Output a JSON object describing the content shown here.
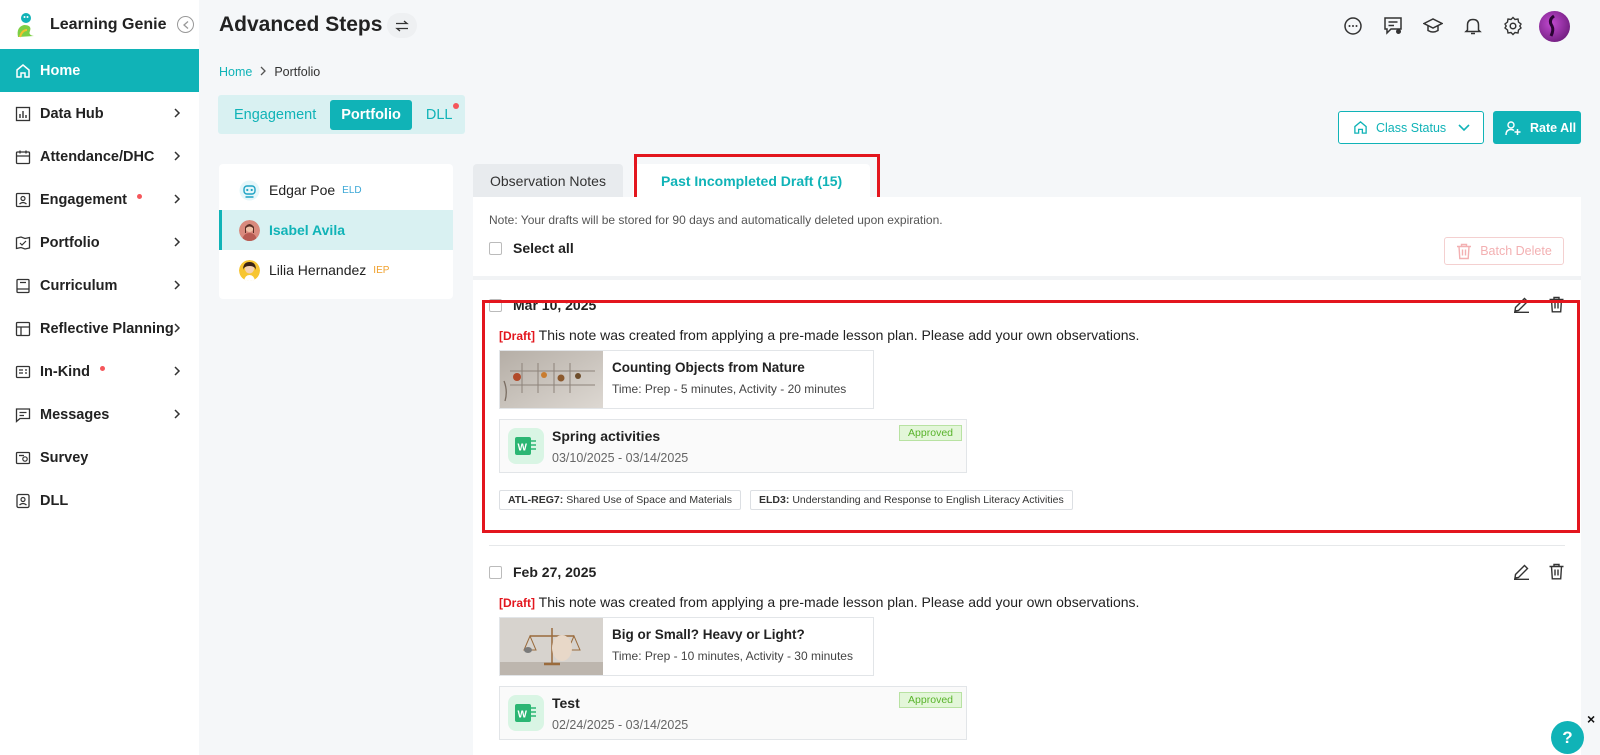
{
  "app": {
    "name": "Learning Genie",
    "logo_icon": "genie-logo-icon"
  },
  "sidebar": {
    "items": [
      {
        "label": "Home",
        "icon": "home-icon",
        "active": true,
        "dot": false,
        "chevron": false
      },
      {
        "label": "Data Hub",
        "icon": "bar-chart-icon",
        "dot": false,
        "chevron": true
      },
      {
        "label": "Attendance/DHC",
        "icon": "calendar-icon",
        "dot": false,
        "chevron": true
      },
      {
        "label": "Engagement",
        "icon": "engagement-icon",
        "dot": true,
        "chevron": true
      },
      {
        "label": "Portfolio",
        "icon": "portfolio-icon",
        "dot": false,
        "chevron": true
      },
      {
        "label": "Curriculum",
        "icon": "book-icon",
        "dot": false,
        "chevron": true
      },
      {
        "label": "Reflective Planning",
        "icon": "planning-icon",
        "dot": false,
        "chevron": true
      },
      {
        "label": "In-Kind",
        "icon": "inkind-icon",
        "dot": true,
        "chevron": true
      },
      {
        "label": "Messages",
        "icon": "message-icon",
        "dot": false,
        "chevron": true
      },
      {
        "label": "Survey",
        "icon": "survey-icon",
        "dot": false,
        "chevron": false
      },
      {
        "label": "DLL",
        "icon": "dll-icon",
        "dot": false,
        "chevron": false
      }
    ]
  },
  "header": {
    "title": "Advanced Steps",
    "icons": [
      "chat-icon",
      "notes-icon",
      "graduation-cap-icon",
      "bell-icon",
      "gear-icon",
      "avatar"
    ]
  },
  "breadcrumb": {
    "home": "Home",
    "current": "Portfolio"
  },
  "subtabs": [
    {
      "label": "Engagement",
      "active": false
    },
    {
      "label": "Portfolio",
      "active": true
    },
    {
      "label": "DLL",
      "active": false,
      "dot": true
    }
  ],
  "actions": {
    "class_status": "Class Status",
    "rate_all": "Rate All"
  },
  "children": [
    {
      "name": "Edgar Poe",
      "tag": "ELD",
      "active": false
    },
    {
      "name": "Isabel Avila",
      "tag": "",
      "active": true
    },
    {
      "name": "Lilia Hernandez",
      "tag": "IEP",
      "active": false
    }
  ],
  "content_tabs": [
    {
      "label": "Observation Notes",
      "active": false
    },
    {
      "label": "Past Incompleted Draft (15)",
      "active": true
    }
  ],
  "panel": {
    "note": "Note: Your drafts will be stored for 90 days and automatically deleted upon expiration.",
    "select_all": "Select all",
    "batch_delete": "Batch Delete"
  },
  "entries": [
    {
      "date": "Mar 10, 2025",
      "draft_tag": "[Draft]",
      "draft_text": "This note was created from applying a pre-made lesson plan. Please add your own observations.",
      "lesson": {
        "title": "Counting Objects from Nature",
        "time": "Time: Prep - 5 minutes, Activity - 20 minutes"
      },
      "plan": {
        "title": "Spring activities",
        "dates": "03/10/2025 - 03/14/2025",
        "status": "Approved"
      },
      "standards": [
        {
          "code": "ATL-REG7:",
          "text": "Shared Use of Space and Materials"
        },
        {
          "code": "ELD3:",
          "text": "Understanding and Response to English Literacy Activities"
        }
      ]
    },
    {
      "date": "Feb 27, 2025",
      "draft_tag": "[Draft]",
      "draft_text": "This note was created from applying a pre-made lesson plan. Please add your own observations.",
      "lesson": {
        "title": "Big or Small? Heavy or Light?",
        "time": "Time: Prep - 10 minutes, Activity - 30 minutes"
      },
      "plan": {
        "title": "Test",
        "dates": "02/24/2025 - 03/14/2025",
        "status": "Approved"
      }
    }
  ],
  "help": {
    "label": "?",
    "close": "×"
  },
  "colors": {
    "brand": "#10b3b7",
    "highlight": "#e3161e",
    "dot": "#f5565b"
  }
}
